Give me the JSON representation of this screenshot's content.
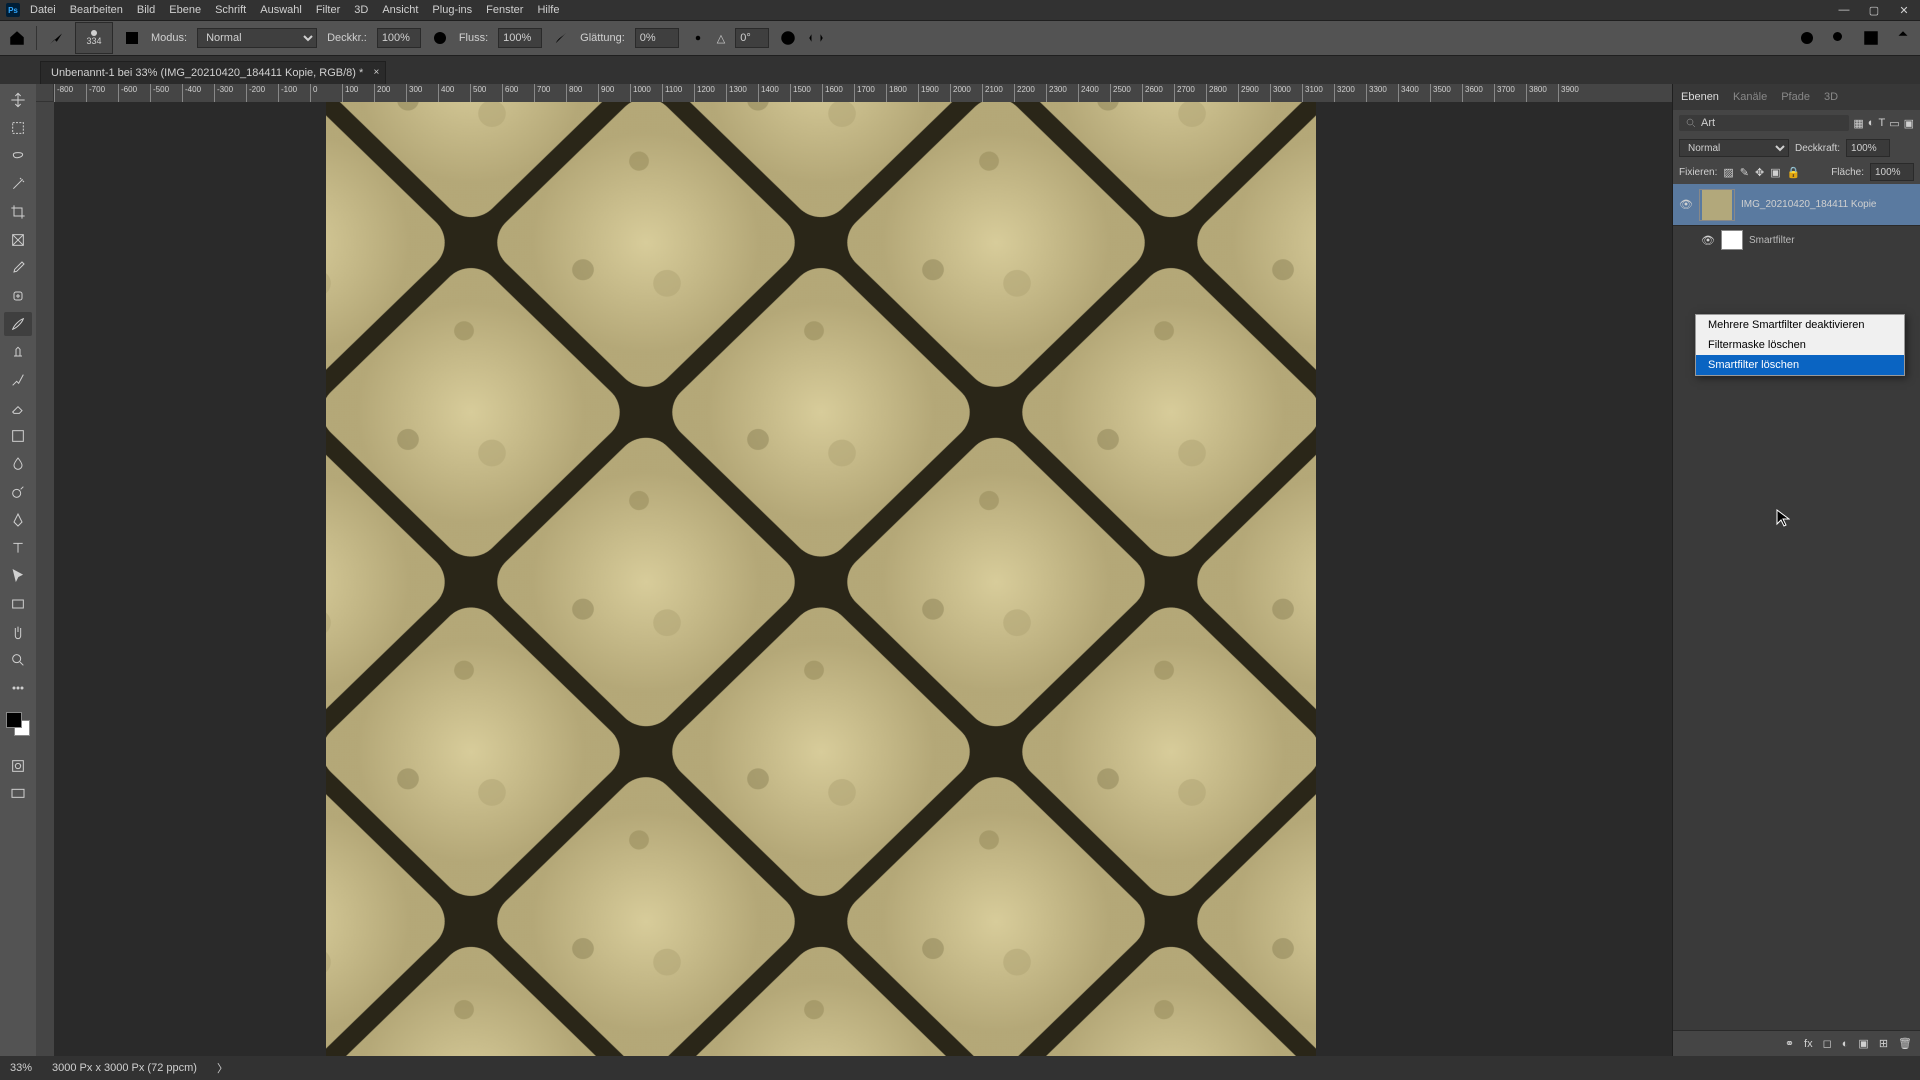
{
  "app": {
    "name": "Ps"
  },
  "menu": [
    "Datei",
    "Bearbeiten",
    "Bild",
    "Ebene",
    "Schrift",
    "Auswahl",
    "Filter",
    "3D",
    "Ansicht",
    "Plug-ins",
    "Fenster",
    "Hilfe"
  ],
  "options": {
    "brush_size": "334",
    "mode_label": "Modus:",
    "mode_value": "Normal",
    "opacity_label": "Deckkr.:",
    "opacity_value": "100%",
    "flow_label": "Fluss:",
    "flow_value": "100%",
    "smooth_label": "Glättung:",
    "smooth_value": "0%",
    "angle_icon": "△",
    "angle_value": "0°"
  },
  "tab": {
    "title": "Unbenannt-1 bei 33% (IMG_20210420_184411 Kopie, RGB/8) *"
  },
  "ruler_marks": [
    "-800",
    "-700",
    "-600",
    "-500",
    "-400",
    "-300",
    "-200",
    "-100",
    "0",
    "100",
    "200",
    "300",
    "400",
    "500",
    "600",
    "700",
    "800",
    "900",
    "1000",
    "1100",
    "1200",
    "1300",
    "1400",
    "1500",
    "1600",
    "1700",
    "1800",
    "1900",
    "2000",
    "2100",
    "2200",
    "2300",
    "2400",
    "2500",
    "2600",
    "2700",
    "2800",
    "2900",
    "3000",
    "3100",
    "3200",
    "3300",
    "3400",
    "3500",
    "3600",
    "3700",
    "3800",
    "3900"
  ],
  "panel": {
    "tabs": [
      "Ebenen",
      "Kanäle",
      "Pfade",
      "3D"
    ],
    "filter_kind": "Art",
    "blend_mode": "Normal",
    "opacity_label": "Deckkraft:",
    "opacity_value": "100%",
    "lock_label": "Fixieren:",
    "fill_label": "Fläche:",
    "fill_value": "100%",
    "layer_name": "IMG_20210420_184411 Kopie",
    "smartfilter_label": "Smartfilter"
  },
  "context_menu": {
    "items": [
      "Mehrere Smartfilter deaktivieren",
      "Filtermaske löschen",
      "Smartfilter löschen"
    ],
    "highlighted_index": 2
  },
  "status": {
    "zoom": "33%",
    "doc": "3000 Px x 3000 Px (72 ppcm)"
  }
}
